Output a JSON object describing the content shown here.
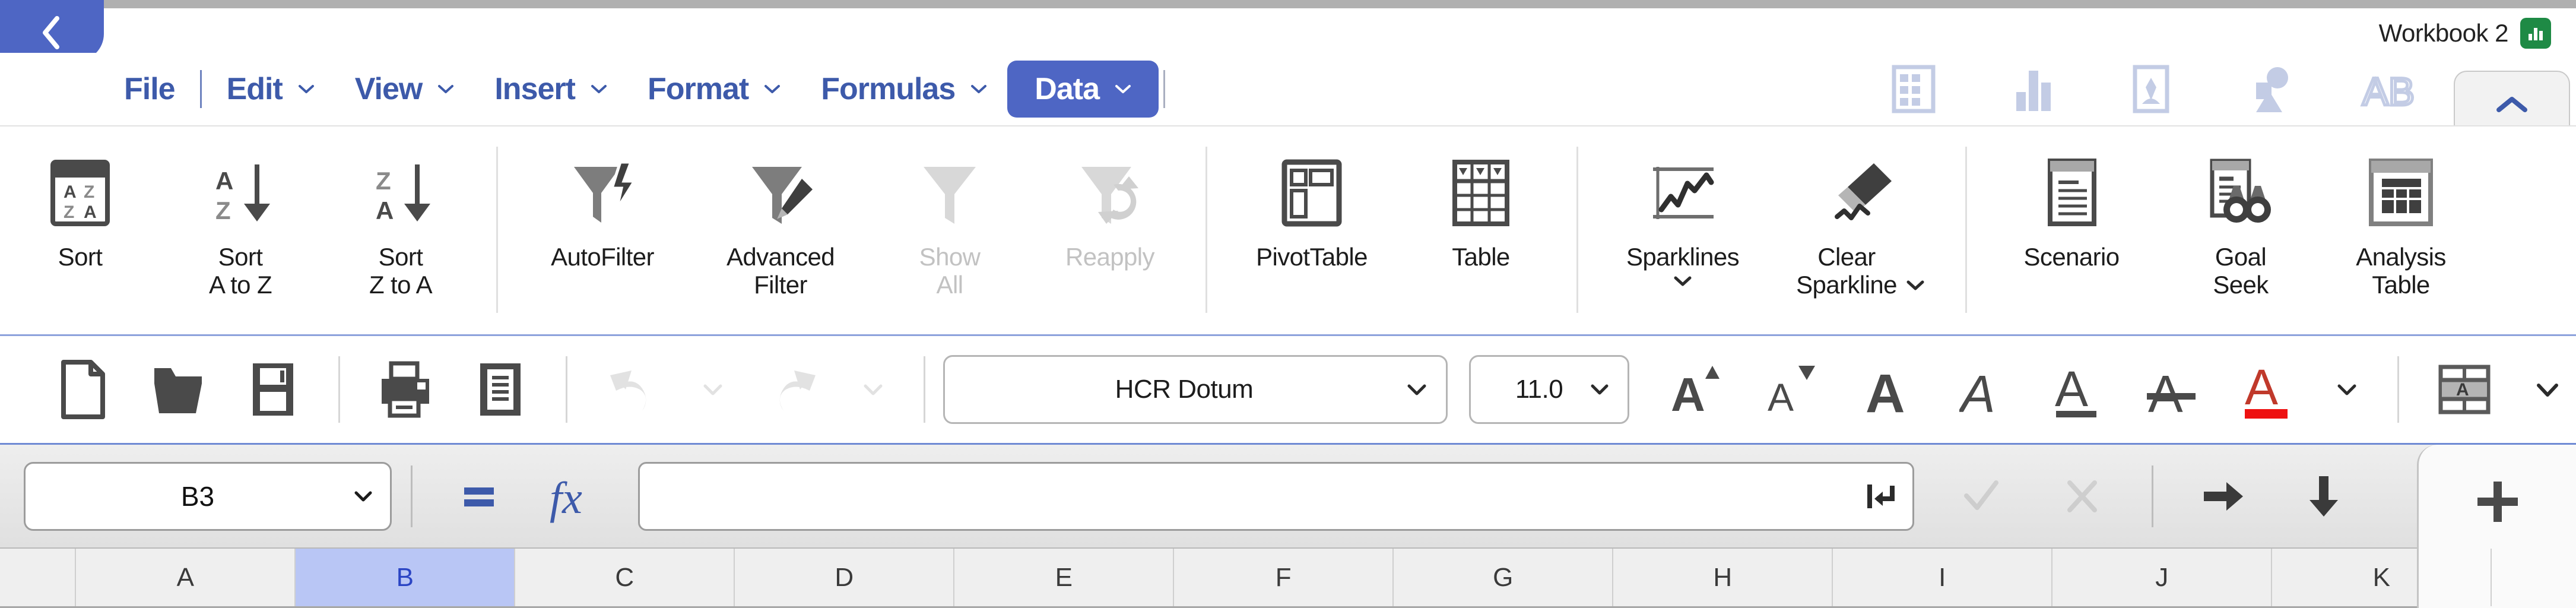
{
  "titlebar": {
    "back_icon": "chevron-left-icon",
    "document_title": "Workbook 2",
    "badge_icon": "spreadsheet-chart-icon"
  },
  "menubar": {
    "items": [
      {
        "label": "File",
        "has_chevron": false,
        "active": false
      },
      {
        "label": "Edit",
        "has_chevron": true,
        "active": false
      },
      {
        "label": "View",
        "has_chevron": true,
        "active": false
      },
      {
        "label": "Insert",
        "has_chevron": true,
        "active": false
      },
      {
        "label": "Format",
        "has_chevron": true,
        "active": false
      },
      {
        "label": "Formulas",
        "has_chevron": true,
        "active": false
      },
      {
        "label": "Data",
        "has_chevron": true,
        "active": true
      }
    ],
    "right_icons": [
      "table-grid-icon",
      "bar-chart-icon",
      "picture-icon",
      "shape-icon",
      "textbox-ab-icon"
    ],
    "collapse_ribbon_icon": "chevron-up-icon",
    "active_color": "#4e66c4",
    "menu_text_color": "#3d5aaa"
  },
  "ribbon": {
    "groups": [
      {
        "name": "sort",
        "items": [
          {
            "label": "Sort",
            "icon": "sort-az-za-icon",
            "disabled": false,
            "chevron": false
          },
          {
            "label": "Sort\nA to Z",
            "icon": "sort-a-to-z-icon",
            "disabled": false,
            "chevron": false
          },
          {
            "label": "Sort\nZ to A",
            "icon": "sort-z-to-a-icon",
            "disabled": false,
            "chevron": false
          }
        ]
      },
      {
        "name": "filter",
        "items": [
          {
            "label": "AutoFilter",
            "icon": "autofilter-icon",
            "disabled": false,
            "chevron": false
          },
          {
            "label": "Advanced\nFilter",
            "icon": "advanced-filter-icon",
            "disabled": false,
            "chevron": false
          },
          {
            "label": "Show\nAll",
            "icon": "show-all-icon",
            "disabled": true,
            "chevron": false
          },
          {
            "label": "Reapply",
            "icon": "reapply-icon",
            "disabled": true,
            "chevron": false
          }
        ]
      },
      {
        "name": "tables",
        "items": [
          {
            "label": "PivotTable",
            "icon": "pivot-table-icon",
            "disabled": false,
            "chevron": false
          },
          {
            "label": "Table",
            "icon": "table-icon",
            "disabled": false,
            "chevron": false
          }
        ]
      },
      {
        "name": "sparklines",
        "items": [
          {
            "label": "Sparklines",
            "icon": "sparklines-icon",
            "disabled": false,
            "chevron": true
          },
          {
            "label": "Clear\nSparkline",
            "icon": "clear-sparkline-icon",
            "disabled": false,
            "chevron": true
          }
        ]
      },
      {
        "name": "analysis",
        "items": [
          {
            "label": "Scenario",
            "icon": "scenario-icon",
            "disabled": false,
            "chevron": false
          },
          {
            "label": "Goal\nSeek",
            "icon": "goal-seek-icon",
            "disabled": false,
            "chevron": false
          },
          {
            "label": "Analysis\nTable",
            "icon": "analysis-table-icon",
            "disabled": false,
            "chevron": false
          }
        ]
      }
    ]
  },
  "format_toolbar": {
    "buttons": [
      {
        "name": "new-document-button",
        "icon": "new-document-icon",
        "disabled": false
      },
      {
        "name": "open-button",
        "icon": "open-folder-icon",
        "disabled": false
      },
      {
        "name": "save-button",
        "icon": "save-floppy-icon",
        "disabled": false
      },
      {
        "name": "print-button",
        "icon": "printer-icon",
        "disabled": false
      },
      {
        "name": "print-preview-button",
        "icon": "print-preview-icon",
        "disabled": false
      },
      {
        "name": "undo-button",
        "icon": "undo-arrow-icon",
        "disabled": true
      },
      {
        "name": "undo-dropdown",
        "icon": "chevron-down-icon",
        "disabled": true
      },
      {
        "name": "redo-button",
        "icon": "redo-arrow-icon",
        "disabled": true
      },
      {
        "name": "redo-dropdown",
        "icon": "chevron-down-icon",
        "disabled": true
      }
    ],
    "font_name": "HCR Dotum",
    "font_size": "11.0",
    "text_buttons": [
      {
        "name": "increase-font-size-button",
        "icon": "increase-font-size-icon"
      },
      {
        "name": "decrease-font-size-button",
        "icon": "decrease-font-size-icon"
      },
      {
        "name": "bold-button",
        "icon": "bold-icon"
      },
      {
        "name": "italic-button",
        "icon": "italic-icon"
      },
      {
        "name": "underline-button",
        "icon": "underline-icon"
      },
      {
        "name": "strikethrough-button",
        "icon": "strikethrough-icon"
      },
      {
        "name": "font-color-button",
        "icon": "font-color-icon"
      },
      {
        "name": "font-color-dropdown",
        "icon": "chevron-down-icon"
      }
    ],
    "font_color": "#ee1111",
    "cell_style_icon": "cell-style-icon",
    "cell_style_dropdown_icon": "chevron-down-icon"
  },
  "formula_bar": {
    "name_box_value": "B3",
    "name_box_dropdown_icon": "chevron-down-icon",
    "equals_icon": "equals-icon",
    "function_icon": "fx-icon",
    "formula_value": "",
    "expand_icon": "wrap-enter-icon",
    "accept_icon": "checkmark-icon",
    "accept_disabled": true,
    "cancel_icon": "cross-icon",
    "cancel_disabled": true,
    "move_right_icon": "arrow-right-icon",
    "move_down_icon": "arrow-down-icon",
    "add_sheet_icon": "plus-icon"
  },
  "grid": {
    "columns": [
      "A",
      "B",
      "C",
      "D",
      "E",
      "F",
      "G",
      "H",
      "I",
      "J",
      "K"
    ],
    "selected_column": "B",
    "selection_color": "#b9c6f5"
  }
}
